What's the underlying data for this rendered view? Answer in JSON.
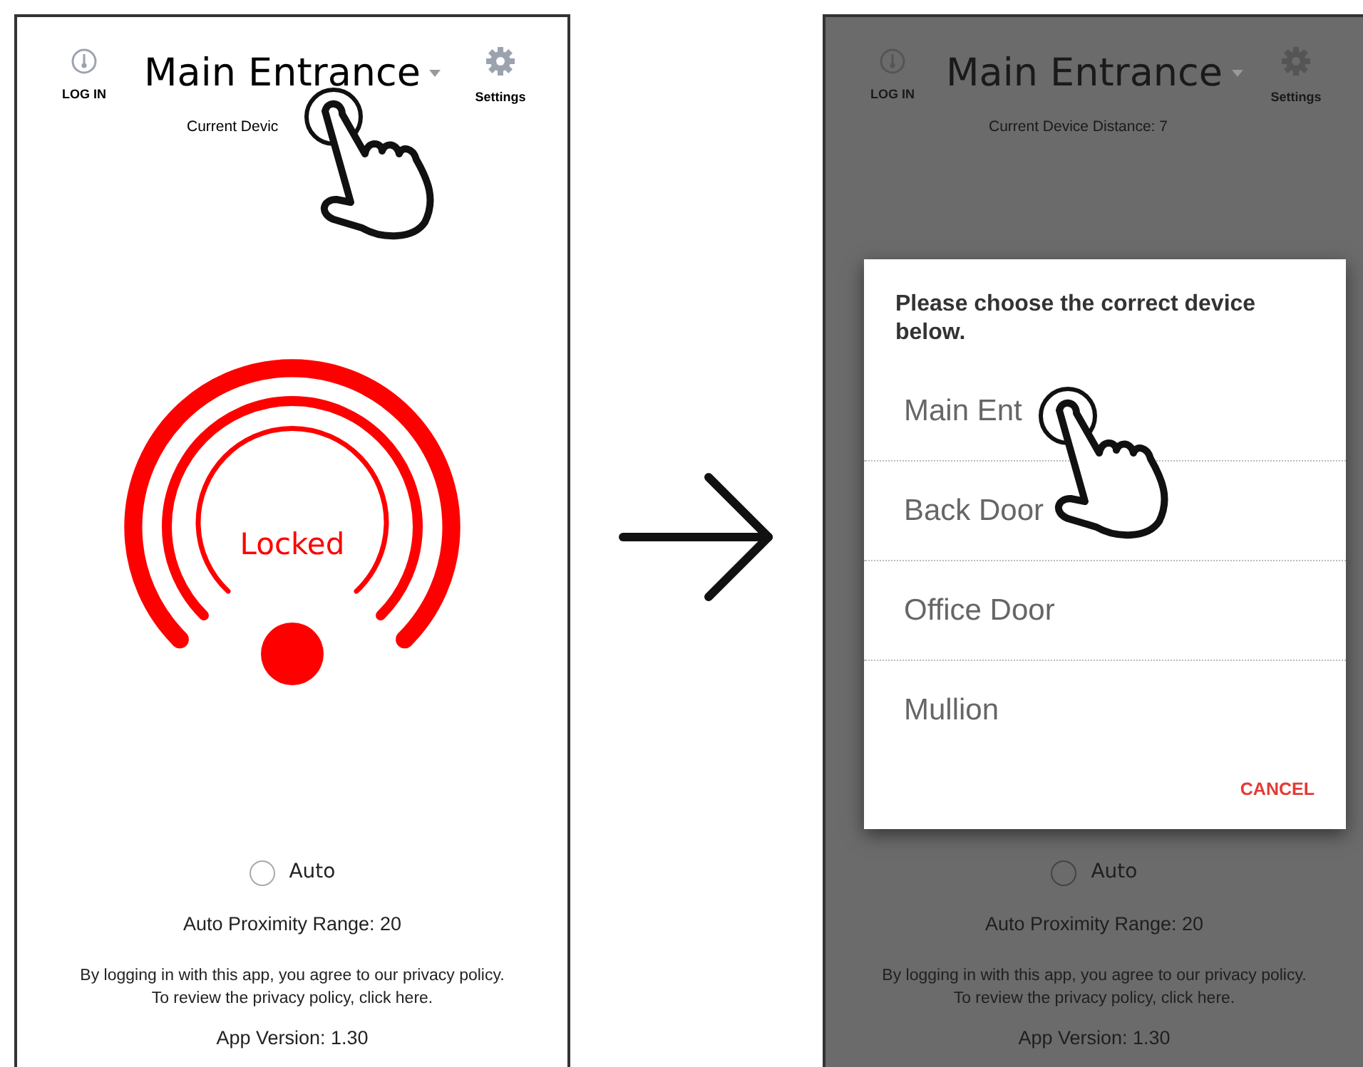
{
  "screens": [
    {
      "kind": "main",
      "header": {
        "login": "LOG IN",
        "title": "Main Entrance",
        "subtitle": "Current Devic",
        "settings": "Settings"
      },
      "lock": {
        "status": "Locked"
      },
      "auto": {
        "label": "Auto",
        "checked": false
      },
      "range": "Auto Proximity Range: 20",
      "policy": [
        "By logging in with this app, you agree to our privacy policy.",
        "To review the privacy policy, click here."
      ],
      "version": "App Version: 1.30"
    },
    {
      "kind": "dimmed",
      "header": {
        "login": "LOG IN",
        "title": "Main Entrance",
        "subtitle": "Current Device Distance: 7",
        "settings": "Settings"
      },
      "dialog": {
        "prompt": "Please choose the correct device below.",
        "options": [
          "Main Ent",
          "Back Door",
          "Office Door",
          "Mullion"
        ],
        "cancel": "CANCEL"
      },
      "auto": {
        "label": "Auto",
        "checked": false
      },
      "range": "Auto Proximity Range: 20",
      "policy": [
        "By logging in with this app, you agree to our privacy policy.",
        "To review the privacy policy, click here."
      ],
      "version": "App Version: 1.30"
    }
  ]
}
